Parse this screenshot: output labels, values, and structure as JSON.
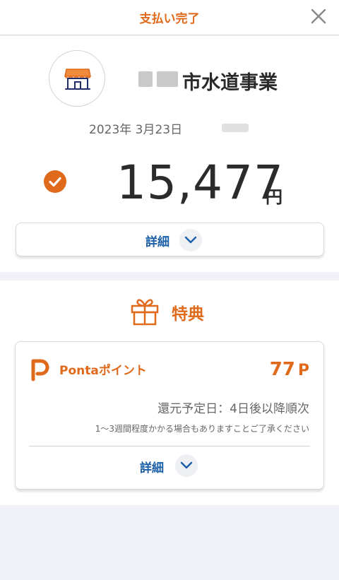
{
  "header": {
    "title": "支払い完了",
    "close_icon": "close-icon"
  },
  "payment": {
    "store_name": "市水道事業",
    "date": "2023年 3月23日",
    "amount": "15,477",
    "currency": "円",
    "detail_label": "詳細",
    "icons": {
      "store": "store-icon",
      "check": "check-circle-icon",
      "chevron": "chevron-down-icon"
    }
  },
  "benefits": {
    "title": "特典",
    "icon": "gift-icon",
    "ponta": {
      "name": "Pontaポイント",
      "points": "77",
      "points_unit": "P",
      "return_date": "還元予定日：4日後以降順次",
      "note": "1〜3週間程度かかる場合もありますことご了承ください",
      "detail_label": "詳細"
    }
  },
  "colors": {
    "accent": "#e06a1c",
    "link": "#1a5fa8",
    "background": "#f1f2f9"
  }
}
